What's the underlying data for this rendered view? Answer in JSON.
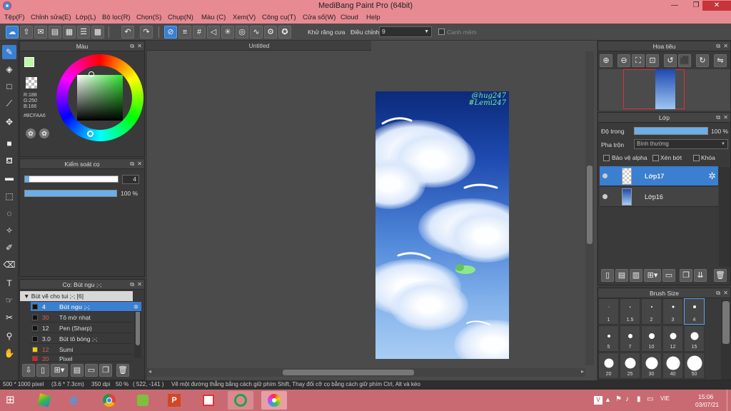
{
  "window": {
    "title": "MediBang Paint Pro (64bit)",
    "minimize": "—",
    "maximize": "❐",
    "close": "✕"
  },
  "menu": [
    "Tệp(F)",
    "Chỉnh sửa(E)",
    "Lớp(L)",
    "Bộ lọc(R)",
    "Chọn(S)",
    "Chụp(N)",
    "Màu (C)",
    "Xem(V)",
    "Công cụ(T)",
    "Cửa sổ(W)",
    "Cloud",
    "Help"
  ],
  "toolbar": {
    "antialias_label": "Khử răng cưa",
    "correction_label": "Điều chỉnh",
    "correction_value": "9",
    "snap_label": "Canh mềm"
  },
  "color_panel": {
    "title": "Màu",
    "r": "R:188",
    "g": "G:250",
    "b": "B:166",
    "hex": "#BCFAA6",
    "primary": "#bcfaa6",
    "secondary": "#7fa8d8"
  },
  "brush_control": {
    "title": "Kiểm soát cọ",
    "size": "4",
    "opacity": "100 %"
  },
  "brush_panel": {
    "title": "Cọ: Bút ngu ;-;",
    "group": "Bút vẽ cho tui ;-; [6]",
    "items": [
      {
        "size": "4",
        "name": "Bút ngu ;-;",
        "color": "#111111"
      },
      {
        "size": "30",
        "name": "Tô mờ nhạt",
        "color": "#111111"
      },
      {
        "size": "12",
        "name": "Pen (Sharp)",
        "color": "#111111"
      },
      {
        "size": "3.0",
        "name": "Bút tô bóng ;-;",
        "color": "#111111"
      },
      {
        "size": "12",
        "name": "Sumi",
        "color": "#f0d000"
      },
      {
        "size": "20",
        "name": "Pixel",
        "color": "#e02020"
      }
    ]
  },
  "document": {
    "tab": "Untitled",
    "signature": "@hug247\n#Lemi247"
  },
  "navigator": {
    "title": "Hoa tiêu"
  },
  "layer_panel": {
    "title": "Lớp",
    "opacity_label": "Độ trong",
    "opacity_value": "100 %",
    "blend_label": "Pha trộn",
    "blend_value": "Bình thường",
    "protect_alpha": "Bảo vệ alpha",
    "clipping": "Xén bớt",
    "lock": "Khóa",
    "layers": [
      {
        "name": "Lớp17",
        "selected": true
      },
      {
        "name": "Lớp16",
        "selected": false
      }
    ]
  },
  "brush_size_panel": {
    "title": "Brush Size",
    "sizes": [
      "1",
      "1.5",
      "2",
      "3",
      "4",
      "5",
      "7",
      "10",
      "12",
      "15",
      "20",
      "25",
      "30",
      "40",
      "50"
    ]
  },
  "status": {
    "size": "500 * 1000 pixel",
    "physical": "(3.6 * 7.3cm)",
    "dpi": "350 dpi",
    "zoom": "50 %",
    "coords": "( 522, -141 )",
    "hint": "Vẽ một đường thẳng bằng cách giữ phím Shift, Thay đổi cỡ cọ bằng cách giữ phím Ctrl, Alt và kéo"
  },
  "taskbar": {
    "lang": "VIE",
    "time": "15:06",
    "date": "03/07/21"
  }
}
